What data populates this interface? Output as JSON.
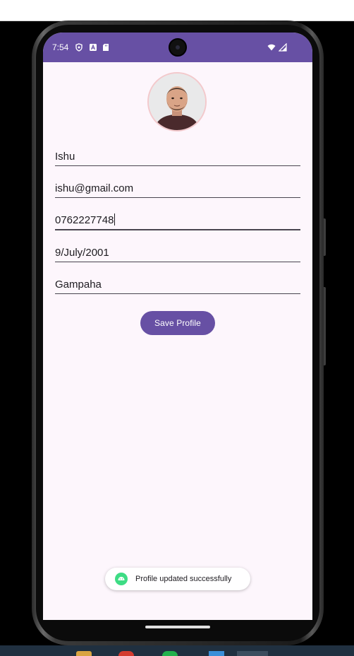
{
  "status_bar": {
    "time": "7:54",
    "color": "#6750a4"
  },
  "profile": {
    "name": "Ishu",
    "email": "ishu@gmail.com",
    "phone": "0762227748",
    "dob": "9/July/2001",
    "city": "Gampaha"
  },
  "save_button": {
    "label": "Save Profile"
  },
  "toast": {
    "message": "Profile updated successfully"
  },
  "icons": {
    "status": [
      "vpn-shield-icon",
      "a-icon",
      "sd-card-icon",
      "wifi-icon",
      "signal-icon"
    ],
    "toast": "android-icon"
  },
  "colors": {
    "accent": "#6750a4",
    "background": "#fdf6fc",
    "toast_icon": "#3ddc84"
  }
}
